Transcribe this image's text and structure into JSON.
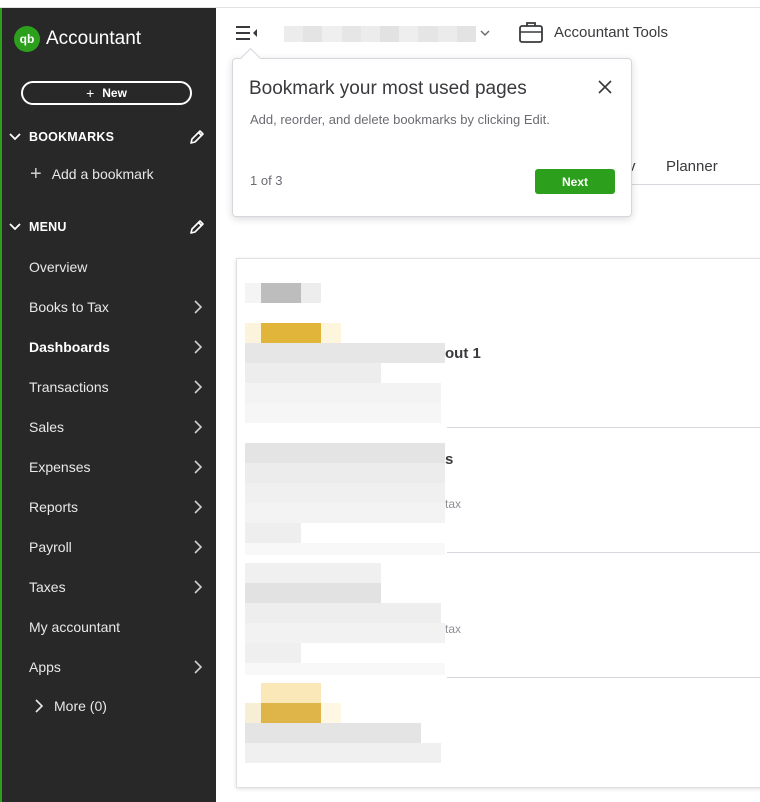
{
  "app": {
    "brand_logo": "qb",
    "brand_name": "Accountant"
  },
  "sidebar": {
    "new_button": "New",
    "bookmarks_header": "BOOKMARKS",
    "add_bookmark": "Add a bookmark",
    "menu_header": "MENU",
    "items": [
      {
        "label": "Overview",
        "arrow": false,
        "bold": false
      },
      {
        "label": "Books to Tax",
        "arrow": true,
        "bold": false
      },
      {
        "label": "Dashboards",
        "arrow": true,
        "bold": true
      },
      {
        "label": "Transactions",
        "arrow": true,
        "bold": false
      },
      {
        "label": "Sales",
        "arrow": true,
        "bold": false
      },
      {
        "label": "Expenses",
        "arrow": true,
        "bold": false
      },
      {
        "label": "Reports",
        "arrow": true,
        "bold": false
      },
      {
        "label": "Payroll",
        "arrow": true,
        "bold": false
      },
      {
        "label": "Taxes",
        "arrow": true,
        "bold": false
      },
      {
        "label": "My accountant",
        "arrow": false,
        "bold": false
      },
      {
        "label": "Apps",
        "arrow": true,
        "bold": false
      }
    ],
    "more": "More (0)"
  },
  "header": {
    "accountant_tools": "Accountant Tools"
  },
  "tabs": {
    "partial": "v",
    "planner": "Planner"
  },
  "popover": {
    "title": "Bookmark your most used pages",
    "description": "Add, reorder, and delete bookmarks by clicking Edit.",
    "step": "1 of 3",
    "next_button": "Next"
  },
  "card": {
    "visible_1": "out 1",
    "visible_2": "s",
    "visible_3": "tax",
    "visible_4": "tax"
  },
  "colors": {
    "brand_green": "#2ca01c",
    "sidebar_bg": "#282828",
    "text_dark": "#393a3d"
  }
}
